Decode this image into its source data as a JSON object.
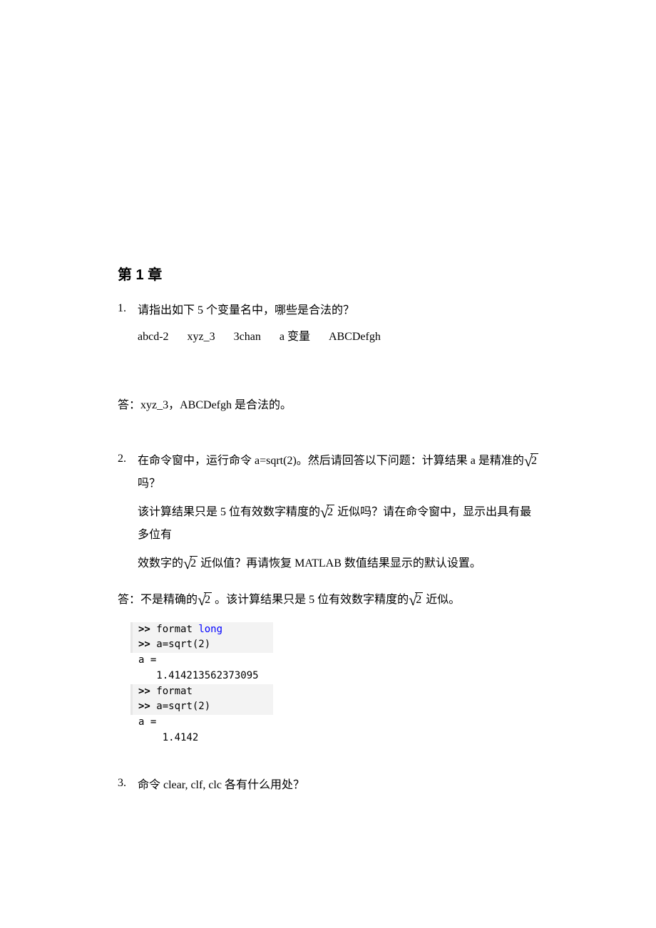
{
  "chapter_title": "第 1 章",
  "q1": {
    "num": "1.",
    "text": "请指出如下 5 个变量名中，哪些是合法的？",
    "vars": [
      "abcd-2",
      "xyz_3",
      "3chan",
      "a 变量",
      "ABCDefgh"
    ]
  },
  "a1": {
    "prefix": "答：",
    "body": "xyz_3，ABCDefgh 是合法的。"
  },
  "q2": {
    "num": "2.",
    "l1a": "在命令窗中，运行命令 a=sqrt(2)。然后请回答以下问题：计算结果 a 是精准的",
    "l1b": " 吗？",
    "l2a": "该计算结果只是 5 位有效数字精度的",
    "l2b": " 近似吗？请在命令窗中，显示出具有最多位有",
    "l3a": "效数字的",
    "l3b": " 近似值？再请恢复 MATLAB 数值结果显示的默认设置。"
  },
  "a2": {
    "prefix": "答：",
    "p1": "不是精确的",
    "p2": " 。该计算结果只是 5 位有效数字精度的",
    "p3": " 近似。"
  },
  "sqrt2": "2",
  "code": {
    "prompt": ">> ",
    "l1_cmd": "format ",
    "l1_kw": "long",
    "l2": "a=sqrt(2)",
    "blank": "",
    "l4": "a =",
    "l6": "   1.414213562373095",
    "l8_cmd": "format",
    "l9": "a=sqrt(2)",
    "l11": "a =",
    "l13": "    1.4142"
  },
  "q3": {
    "num": "3.",
    "text": "命令 clear, clf, clc 各有什么用处？"
  }
}
